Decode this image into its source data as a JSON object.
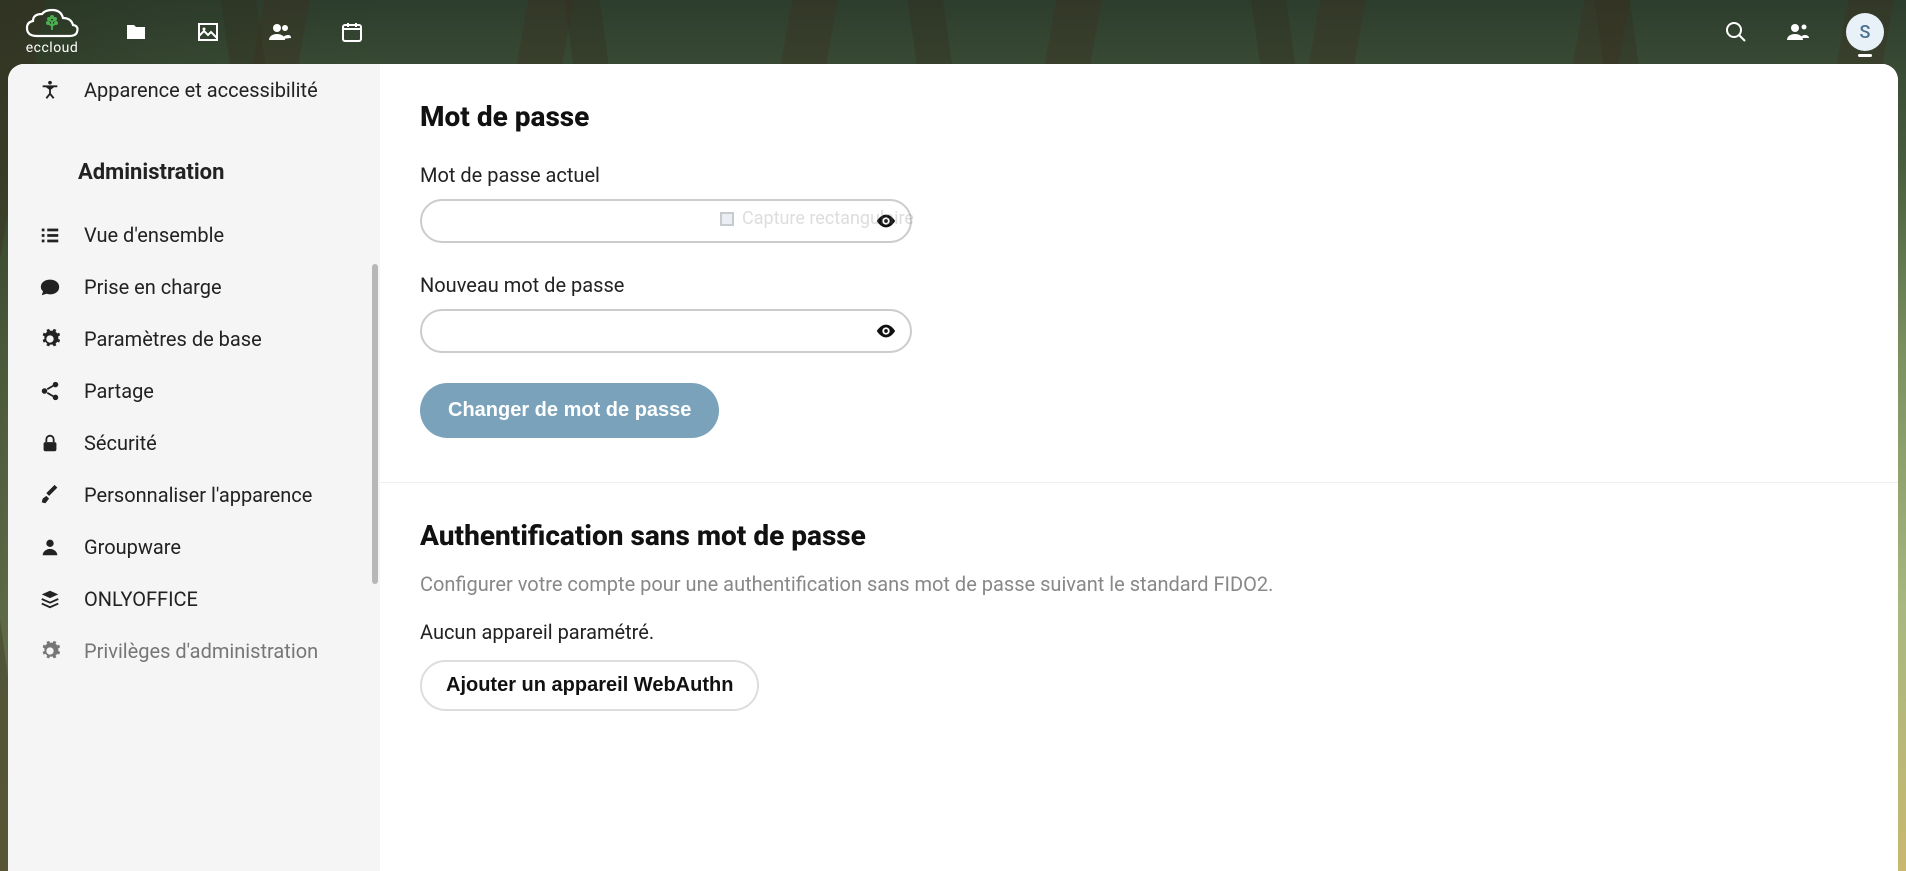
{
  "logo_text": "eccloud",
  "avatar_initial": "S",
  "sidebar": {
    "top_item": {
      "label": "Apparence et accessibilité"
    },
    "section_header": "Administration",
    "items": [
      {
        "label": "Vue d'ensemble"
      },
      {
        "label": "Prise en charge"
      },
      {
        "label": "Paramètres de base"
      },
      {
        "label": "Partage"
      },
      {
        "label": "Sécurité"
      },
      {
        "label": "Personnaliser l'apparence"
      },
      {
        "label": "Groupware"
      },
      {
        "label": "ONLYOFFICE"
      },
      {
        "label": "Privilèges d'administration"
      }
    ]
  },
  "password_section": {
    "title": "Mot de passe",
    "current_label": "Mot de passe actuel",
    "new_label": "Nouveau mot de passe",
    "current_value": "",
    "new_value": "",
    "submit_label": "Changer de mot de passe"
  },
  "webauthn_section": {
    "title": "Authentification sans mot de passe",
    "description": "Configurer votre compte pour une authentification sans mot de passe suivant le standard FIDO2.",
    "status": "Aucun appareil paramétré.",
    "add_button": "Ajouter un appareil WebAuthn"
  },
  "capture_hint": "Capture rectangulaire"
}
